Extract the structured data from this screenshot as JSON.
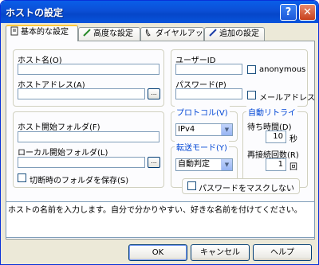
{
  "window": {
    "title": "ホストの設定",
    "help_btn": "?",
    "close_btn": "✕"
  },
  "tabs": [
    {
      "label": "基本的な設定",
      "icon": "document-icon"
    },
    {
      "label": "高度な設定",
      "icon": "pencil-icon"
    },
    {
      "label": "ダイヤルアップ",
      "icon": "phone-icon"
    },
    {
      "label": "追加の設定",
      "icon": "pen-icon"
    }
  ],
  "host": {
    "host_name_label": "ホスト名(O)",
    "host_name_value": "",
    "host_address_label": "ホストアドレス(A)",
    "host_address_value": "",
    "browse": "..."
  },
  "user": {
    "user_id_label": "ユーザーID",
    "user_id_value": "",
    "anonymous_label": "anonymous",
    "password_label": "パスワード(P)",
    "password_value": "",
    "mail_label": "メールアドレス"
  },
  "folders": {
    "host_start_label": "ホスト開始フォルダ(F)",
    "host_start_value": "",
    "local_start_label": "ローカル開始フォルダ(L)",
    "local_start_value": "",
    "save_on_exit_label": "切断時のフォルダを保存(S)"
  },
  "protocol": {
    "label": "プロトコル(V)",
    "value": "IPv4"
  },
  "transfer_mode": {
    "label": "転送モード(Y)",
    "value": "自動判定"
  },
  "retry": {
    "label": "自動リトライ",
    "wait_label": "待ち時間(D)",
    "wait_value": "10",
    "wait_unit": "秒",
    "reconnect_label": "再接続回数(R)",
    "reconnect_value": "1",
    "reconnect_unit": "回"
  },
  "mask_password_label": "パスワードをマスクしない",
  "status_text": "ホストの名前を入力します。自分で分かりやすい、好きな名前を付けてください。",
  "buttons": {
    "ok": "OK",
    "cancel": "キャンセル",
    "help": "ヘルプ"
  }
}
